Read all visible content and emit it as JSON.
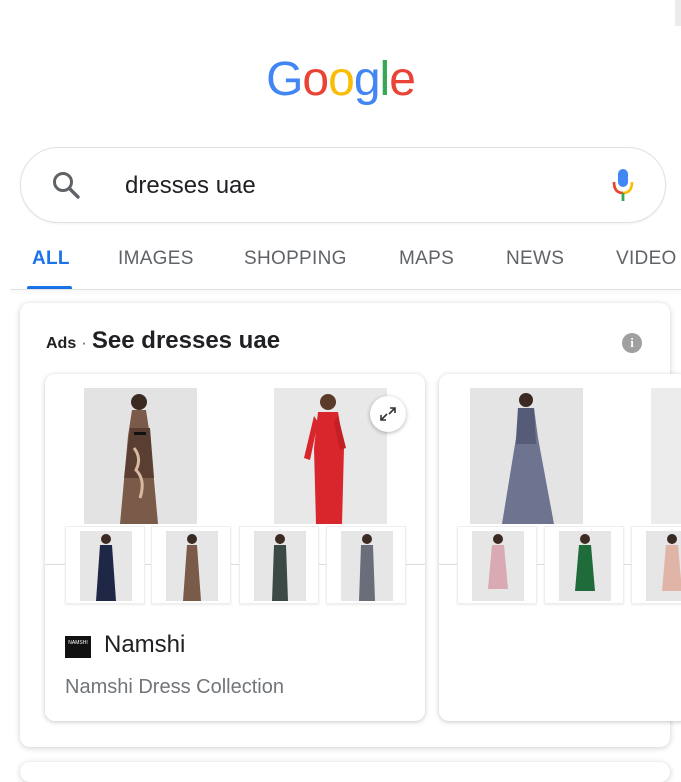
{
  "logo": {
    "letters": [
      "G",
      "o",
      "o",
      "g",
      "l",
      "e"
    ],
    "colors": [
      "#4285f4",
      "#ea4335",
      "#fbbc05",
      "#4285f4",
      "#34a853",
      "#ea4335"
    ]
  },
  "search": {
    "query": "dresses uae",
    "search_icon": "search-icon",
    "mic_icon": "mic-icon"
  },
  "tabs": [
    {
      "label": "ALL",
      "active": true
    },
    {
      "label": "IMAGES",
      "active": false
    },
    {
      "label": "SHOPPING",
      "active": false
    },
    {
      "label": "MAPS",
      "active": false
    },
    {
      "label": "NEWS",
      "active": false
    },
    {
      "label": "VIDEO",
      "active": false
    }
  ],
  "ads": {
    "label": "Ads",
    "separator": "·",
    "title": "See dresses uae",
    "info_icon": "info-icon"
  },
  "cards": [
    {
      "merchant_logo_text": "NAMSHI",
      "merchant": "Namshi",
      "description": "Namshi Dress Collection",
      "expand_icon": "expand-icon"
    },
    {
      "merchant": "",
      "description": ""
    }
  ],
  "colors": {
    "accent": "#1a73e8",
    "text_secondary": "#5f6368",
    "text_muted": "#70757a",
    "card_border": "#dadce0"
  }
}
